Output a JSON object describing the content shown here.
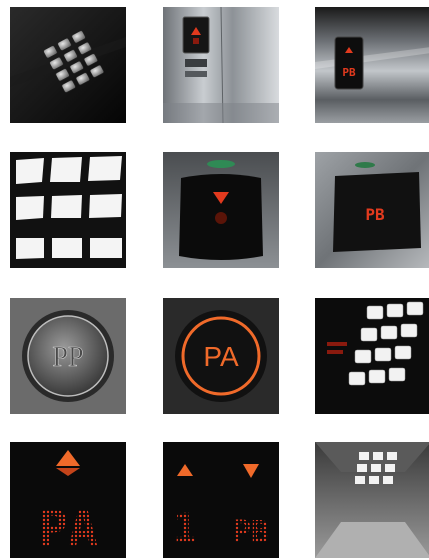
{
  "tiles": [
    {
      "row": 1,
      "col": 1,
      "subject": "dark keypad with 12 buttons"
    },
    {
      "row": 1,
      "col": 2,
      "subject": "stainless elevator panel with red arrow"
    },
    {
      "row": 1,
      "col": 3,
      "subject": "steel wall display"
    },
    {
      "row": 2,
      "col": 1,
      "subject": "grid of lit white panels"
    },
    {
      "row": 2,
      "col": 2,
      "subject": "black display with red down arrow"
    },
    {
      "row": 2,
      "col": 3,
      "subject": "steel display"
    },
    {
      "row": 3,
      "col": 1,
      "subject": "embossed metal button"
    },
    {
      "row": 3,
      "col": 2,
      "subject": "illuminated orange ring button"
    },
    {
      "row": 3,
      "col": 3,
      "subject": "white button grid with red text"
    },
    {
      "row": 4,
      "col": 1,
      "subject": "dot-matrix display with up arrow"
    },
    {
      "row": 4,
      "col": 2,
      "subject": "dot-matrix display with up and down arrows"
    },
    {
      "row": 4,
      "col": 3,
      "subject": "ceiling with light grid"
    }
  ],
  "labels": {
    "r1c3_display": "PB",
    "r2c3_display": "PB",
    "r3c1_button": "PP",
    "r3c2_button": "PA",
    "r4c1_display": "PA",
    "r4c2_left": "1",
    "r4c2_right": "PB"
  },
  "colors": {
    "accent_red": "#e23a1e",
    "accent_orange": "#f06a2a",
    "steel": "#9aa0a6"
  }
}
